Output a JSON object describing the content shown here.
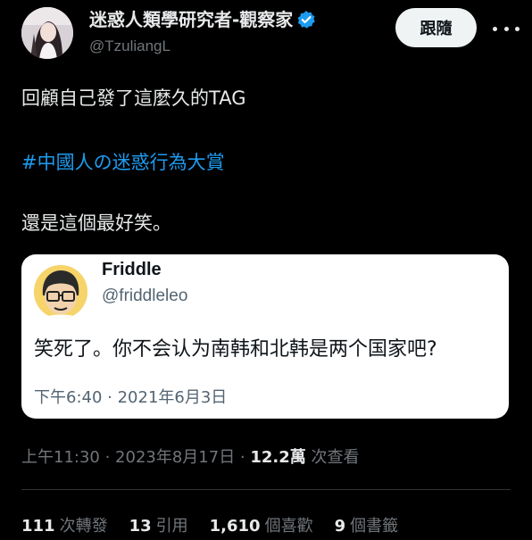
{
  "author": {
    "name": "迷惑人類學研究者-觀察家",
    "handle": "@TzuliangL",
    "verified": true,
    "verified_color": "#1d9bf0"
  },
  "header": {
    "follow_label": "跟隨",
    "more_icon": "more-horizontal-icon"
  },
  "tweet": {
    "line1": "回顧自己發了這麼久的TAG",
    "hashtag": "#中國人の迷惑行為大賞",
    "line3": "還是這個最好笑。"
  },
  "quote": {
    "name": "Friddle",
    "handle": "@friddleleo",
    "text": "笑死了。你不会认为南韩和北韩是两个国家吧?",
    "timestamp": "下午6:40 · 2021年6月3日"
  },
  "meta": {
    "time_date": "上午11:30 · 2023年8月17日 · ",
    "views_count": "12.2萬",
    "views_label": " 次查看"
  },
  "stats": [
    {
      "num": "111",
      "label": "次轉發"
    },
    {
      "num": "13",
      "label": "引用"
    },
    {
      "num": "1,610",
      "label": "個喜歡"
    },
    {
      "num": "9",
      "label": "個書籤"
    }
  ],
  "colors": {
    "background": "#000000",
    "text": "#e7e9ea",
    "muted": "#71767b",
    "link": "#1d9bf0",
    "follow_bg": "#eff3f4",
    "card_bg": "#ffffff"
  }
}
